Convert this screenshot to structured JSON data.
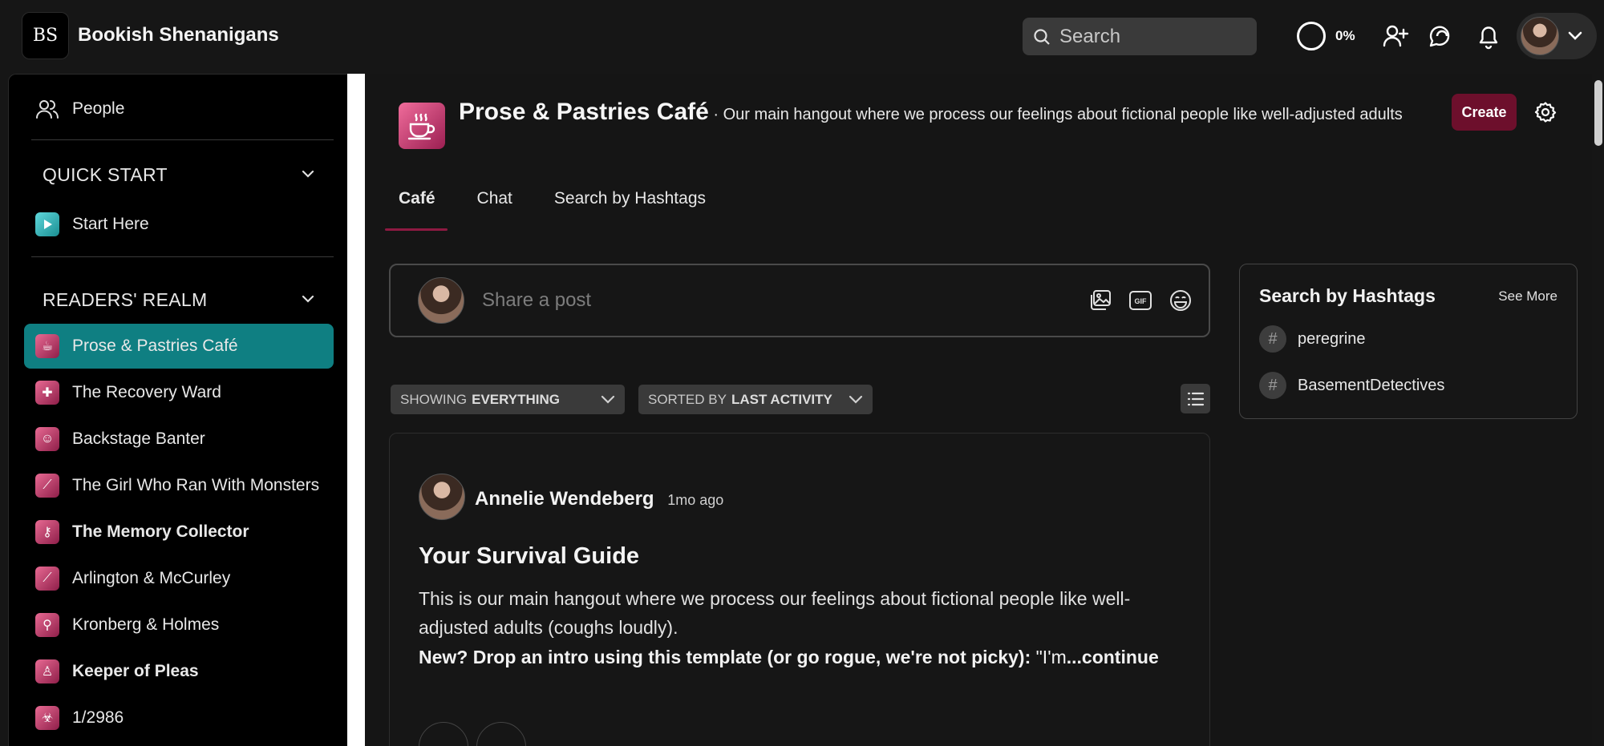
{
  "app": {
    "logo_text": "BS",
    "name": "Bookish Shenanigans"
  },
  "topbar": {
    "search_placeholder": "Search",
    "progress_label": "0%",
    "icons": [
      "search-icon",
      "add-user-icon",
      "chat-bubbles-icon",
      "bell-icon",
      "chevron-down-icon"
    ]
  },
  "sidebar": {
    "people_label": "People",
    "quick_start": {
      "heading": "QUICK START",
      "items": [
        {
          "label": "Start Here"
        }
      ]
    },
    "readers_realm": {
      "heading": "READERS' REALM",
      "items": [
        {
          "label": "Prose & Pastries Café",
          "active": true
        },
        {
          "label": "The Recovery Ward"
        },
        {
          "label": "Backstage Banter"
        },
        {
          "label": "The Girl Who Ran With Monsters"
        },
        {
          "label": "The Memory Collector",
          "bold": true
        },
        {
          "label": "Arlington & McCurley"
        },
        {
          "label": "Kronberg & Holmes"
        },
        {
          "label": "Keeper of Pleas",
          "bold": true
        },
        {
          "label": "1/2986"
        }
      ]
    }
  },
  "group": {
    "name": "Prose & Pastries Café",
    "description": " · Our main hangout where we process our feelings about fictional people like well-adjusted adults",
    "create_label": "Create",
    "tabs": [
      "Café",
      "Chat",
      "Search by Hashtags"
    ]
  },
  "composer": {
    "placeholder": "Share a post"
  },
  "filters": {
    "showing_prefix": "SHOWING",
    "showing_value": "EVERYTHING",
    "sorted_prefix": "SORTED BY",
    "sorted_value": "LAST ACTIVITY"
  },
  "post": {
    "author": "Annelie Wendeberg",
    "time": "1mo ago",
    "title": "Your Survival Guide",
    "body": "This is our main hangout where we process our feelings about fictional people like well-adjusted adults (coughs loudly).",
    "more_bold": "New? Drop an intro using this template (or go rogue, we're not picky):",
    "more_plain": " \"I'm",
    "more_link": "...continue"
  },
  "hashtags": {
    "title": "Search by Hashtags",
    "see_more": "See More",
    "tags": [
      "peregrine",
      "BasementDetectives"
    ]
  },
  "colors": {
    "accent_teal": "#0f7f82",
    "brand_maroon": "#6d0f2c",
    "tab_underline": "#8e1a42"
  }
}
